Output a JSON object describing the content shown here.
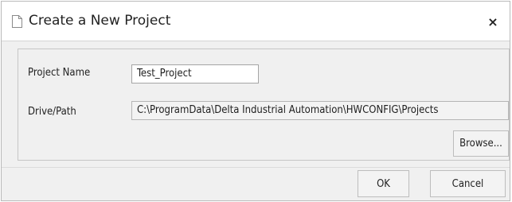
{
  "dialog": {
    "title": "Create a New Project",
    "title_icon": "document-icon",
    "close_label": "×"
  },
  "form": {
    "project_name_label": "Project Name",
    "project_name_value": "Test_Project",
    "drive_path_label": "Drive/Path",
    "drive_path_value": "C:\\ProgramData\\Delta Industrial Automation\\HWCONFIG\\Projects",
    "browse_label": "Browse..."
  },
  "footer": {
    "ok_label": "OK",
    "cancel_label": "Cancel"
  }
}
